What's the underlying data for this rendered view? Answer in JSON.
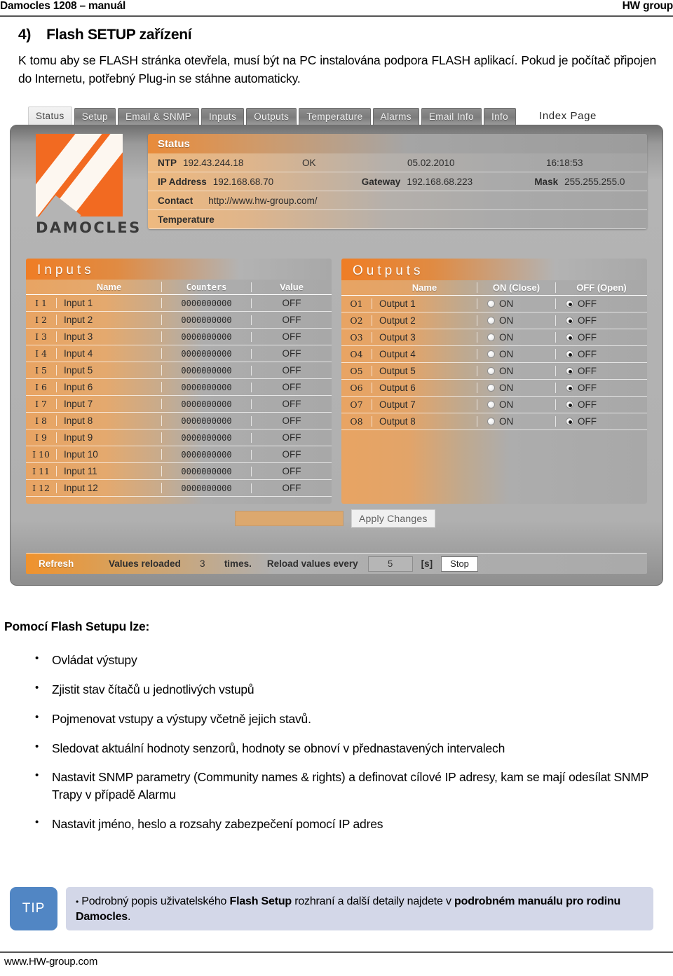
{
  "header": {
    "left": "Damocles 1208 – manuál",
    "right": "HW group"
  },
  "section": {
    "number": "4)",
    "title": "Flash SETUP zařízení"
  },
  "intro": "K tomu aby se FLASH stránka otevřela, musí být na PC instalována podpora FLASH aplikací. Pokud je počítač připojen do Internetu, potřebný Plug-in se stáhne automaticky.",
  "app": {
    "tabs": [
      {
        "label": "Status",
        "active": true
      },
      {
        "label": "Setup",
        "active": false
      },
      {
        "label": "Email & SNMP",
        "active": false
      },
      {
        "label": "Inputs",
        "active": false
      },
      {
        "label": "Outputs",
        "active": false
      },
      {
        "label": "Temperature",
        "active": false
      },
      {
        "label": "Alarms",
        "active": false
      },
      {
        "label": "Email Info",
        "active": false
      },
      {
        "label": "Info",
        "active": false
      }
    ],
    "index_page": "Index Page",
    "logo_text": "DAMOCLES",
    "status": {
      "title": "Status",
      "ntp_label": "NTP",
      "ntp_value": "192.43.244.18",
      "ntp_state": "OK",
      "date": "05.02.2010",
      "time": "16:18:53",
      "ip_label": "IP Address",
      "ip_value": "192.168.68.70",
      "gateway_label": "Gateway",
      "gateway_value": "192.168.68.223",
      "mask_label": "Mask",
      "mask_value": "255.255.255.0",
      "contact_label": "Contact",
      "contact_value": "http://www.hw-group.com/",
      "temperature_label": "Temperature"
    },
    "inputs": {
      "title": "Inputs",
      "columns": {
        "name": "Name",
        "counters": "Counters",
        "value": "Value"
      },
      "rows": [
        {
          "id": "I 1",
          "name": "Input 1",
          "counter": "0000000000",
          "value": "OFF"
        },
        {
          "id": "I 2",
          "name": "Input 2",
          "counter": "0000000000",
          "value": "OFF"
        },
        {
          "id": "I 3",
          "name": "Input 3",
          "counter": "0000000000",
          "value": "OFF"
        },
        {
          "id": "I 4",
          "name": "Input 4",
          "counter": "0000000000",
          "value": "OFF"
        },
        {
          "id": "I 5",
          "name": "Input 5",
          "counter": "0000000000",
          "value": "OFF"
        },
        {
          "id": "I 6",
          "name": "Input 6",
          "counter": "0000000000",
          "value": "OFF"
        },
        {
          "id": "I 7",
          "name": "Input 7",
          "counter": "0000000000",
          "value": "OFF"
        },
        {
          "id": "I 8",
          "name": "Input 8",
          "counter": "0000000000",
          "value": "OFF"
        },
        {
          "id": "I 9",
          "name": "Input 9",
          "counter": "0000000000",
          "value": "OFF"
        },
        {
          "id": "I 10",
          "name": "Input 10",
          "counter": "0000000000",
          "value": "OFF"
        },
        {
          "id": "I 11",
          "name": "Input 11",
          "counter": "0000000000",
          "value": "OFF"
        },
        {
          "id": "I 12",
          "name": "Input 12",
          "counter": "0000000000",
          "value": "OFF"
        }
      ]
    },
    "outputs": {
      "title": "Outputs",
      "columns": {
        "name": "Name",
        "on": "ON (Close)",
        "off": "OFF (Open)"
      },
      "on_label": "ON",
      "off_label": "OFF",
      "rows": [
        {
          "id": "O1",
          "name": "Output 1",
          "selected": "off"
        },
        {
          "id": "O2",
          "name": "Output 2",
          "selected": "off"
        },
        {
          "id": "O3",
          "name": "Output 3",
          "selected": "off"
        },
        {
          "id": "O4",
          "name": "Output 4",
          "selected": "off"
        },
        {
          "id": "O5",
          "name": "Output 5",
          "selected": "off"
        },
        {
          "id": "O6",
          "name": "Output 6",
          "selected": "off"
        },
        {
          "id": "O7",
          "name": "Output 7",
          "selected": "off"
        },
        {
          "id": "O8",
          "name": "Output 8",
          "selected": "off"
        }
      ]
    },
    "apply_label": "Apply Changes",
    "refresh": {
      "refresh_label": "Refresh",
      "reloaded_label": "Values reloaded",
      "count": "3",
      "times_label": "times.",
      "every_label": "Reload values every",
      "interval": "5",
      "unit": "[s]",
      "stop_label": "Stop"
    },
    "colors": {
      "accent_orange": "#f26a21",
      "panel_gray": "#b4b4b4",
      "row_orange": "#e8a463"
    }
  },
  "lead": "Pomocí Flash Setupu lze:",
  "bullets": [
    "Ovládat výstupy",
    "Zjistit stav čítačů u jednotlivých vstupů",
    "Pojmenovat vstupy a výstupy včetně jejich stavů.",
    "Sledovat aktuální hodnoty senzorů, hodnoty se obnoví v přednastavených intervalech",
    "Nastavit SNMP parametry (Community names & rights) a definovat cílové IP adresy, kam se mají odesílat SNMP Trapy v případě Alarmu",
    "Nastavit jméno, heslo a rozsahy zabezpečení pomocí IP adres"
  ],
  "tip": {
    "badge": "TIP",
    "text_1": "Podrobný popis uživatelského ",
    "bold_1": "Flash Setup",
    "text_2": " rozhraní  a další detaily najdete v ",
    "bold_2": "podrobném manuálu pro rodinu Damocles",
    "text_3": "."
  },
  "footer": "www.HW-group.com",
  "tip_colors": {
    "badge": "#5186c4",
    "body": "#d3d7e8"
  }
}
